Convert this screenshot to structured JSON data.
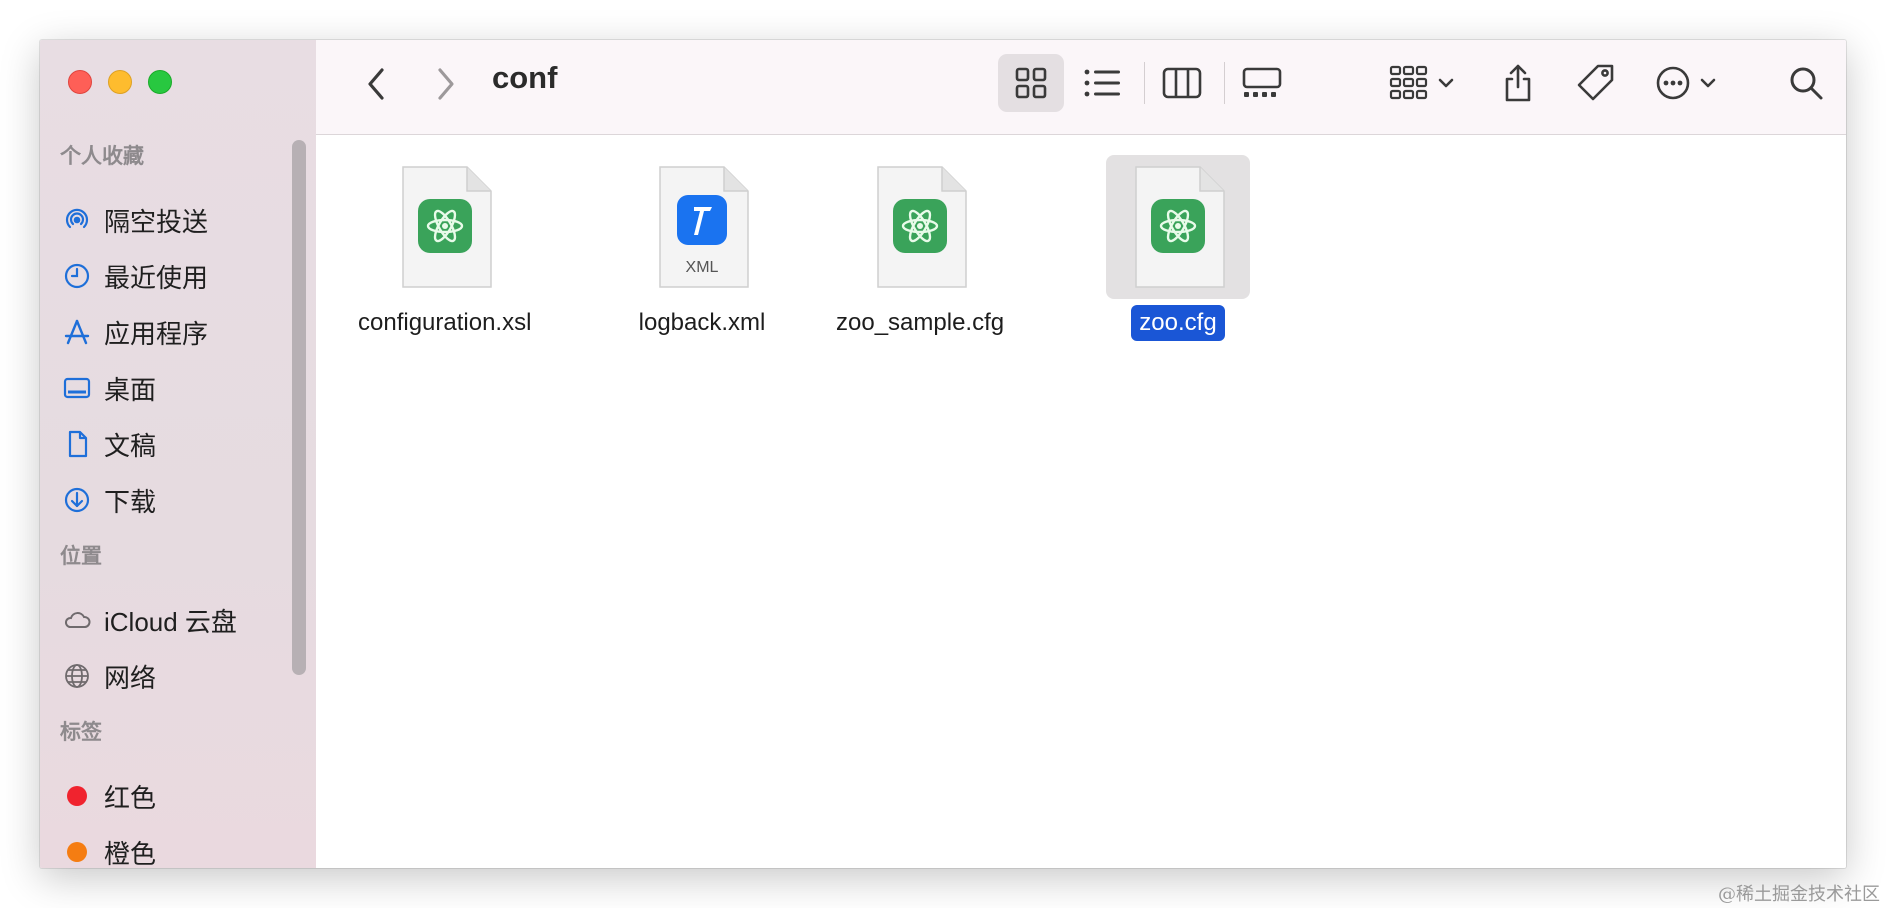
{
  "window": {
    "title": "conf"
  },
  "sidebar": {
    "favorites_title": "个人收藏",
    "favorites": [
      {
        "label": "隔空投送",
        "icon": "airdrop-icon"
      },
      {
        "label": "最近使用",
        "icon": "clock-icon"
      },
      {
        "label": "应用程序",
        "icon": "applications-icon"
      },
      {
        "label": "桌面",
        "icon": "desktop-icon"
      },
      {
        "label": "文稿",
        "icon": "document-icon"
      },
      {
        "label": "下载",
        "icon": "download-icon"
      }
    ],
    "locations_title": "位置",
    "locations": [
      {
        "label": "iCloud 云盘",
        "icon": "cloud-icon"
      },
      {
        "label": "网络",
        "icon": "globe-icon"
      }
    ],
    "tags_title": "标签",
    "tags": [
      {
        "label": "红色",
        "color": "#f0232e"
      },
      {
        "label": "橙色",
        "color": "#f57d12"
      }
    ]
  },
  "files": [
    {
      "name": "configuration.xsl",
      "icon": "atom-file-icon",
      "selected": false
    },
    {
      "name": "logback.xml",
      "icon": "xml-file-icon",
      "badge": "XML",
      "selected": false
    },
    {
      "name": "zoo_sample.cfg",
      "icon": "atom-file-icon",
      "selected": false
    },
    {
      "name": "zoo.cfg",
      "icon": "atom-file-icon",
      "selected": true
    }
  ],
  "watermark": "@稀土掘金技术社区",
  "colors": {
    "selection": "#1a56d6",
    "atom_green": "#3aa35a",
    "xml_blue": "#1a73f0"
  }
}
